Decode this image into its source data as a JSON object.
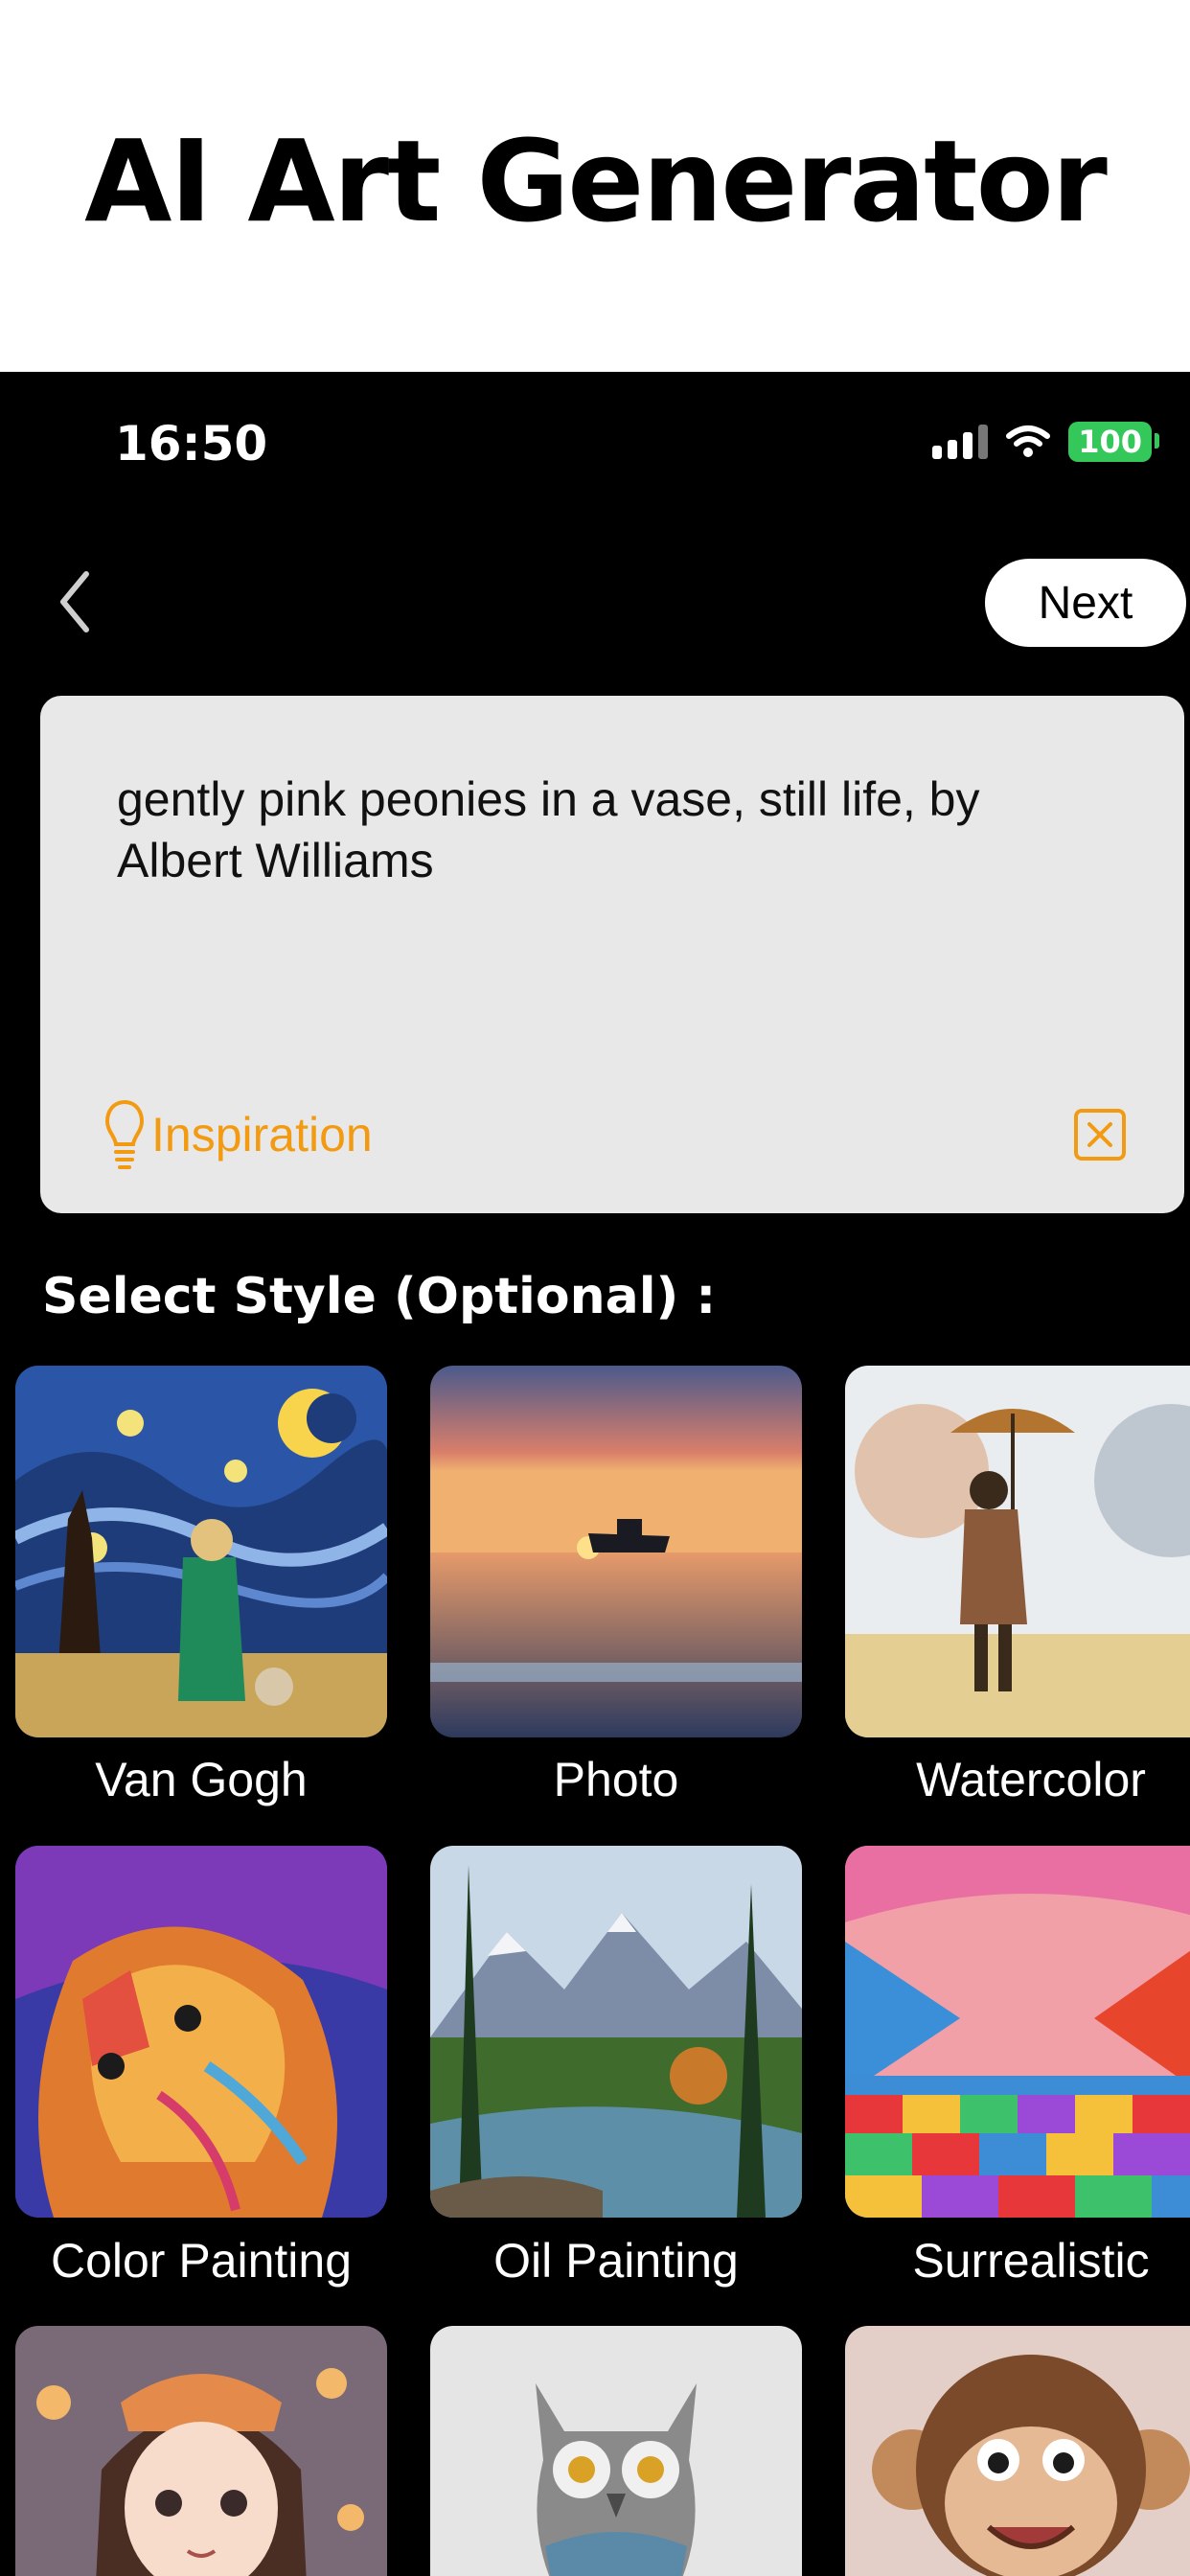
{
  "page_title": "AI Art Generator",
  "status_bar": {
    "time": "16:50",
    "battery": "100"
  },
  "nav": {
    "next_label": "Next"
  },
  "prompt": {
    "text": "gently pink peonies in a vase, still life, by Albert Williams",
    "inspiration_label": "Inspiration"
  },
  "styles": {
    "heading": "Select Style (Optional) :",
    "items": [
      {
        "label": "Van Gogh"
      },
      {
        "label": "Photo"
      },
      {
        "label": "Watercolor"
      },
      {
        "label": "Color Painting"
      },
      {
        "label": "Oil Painting"
      },
      {
        "label": "Surrealistic"
      },
      {
        "label": ""
      },
      {
        "label": ""
      },
      {
        "label": ""
      }
    ]
  },
  "colors": {
    "accent": "#f29b12",
    "battery_green": "#34c759"
  }
}
